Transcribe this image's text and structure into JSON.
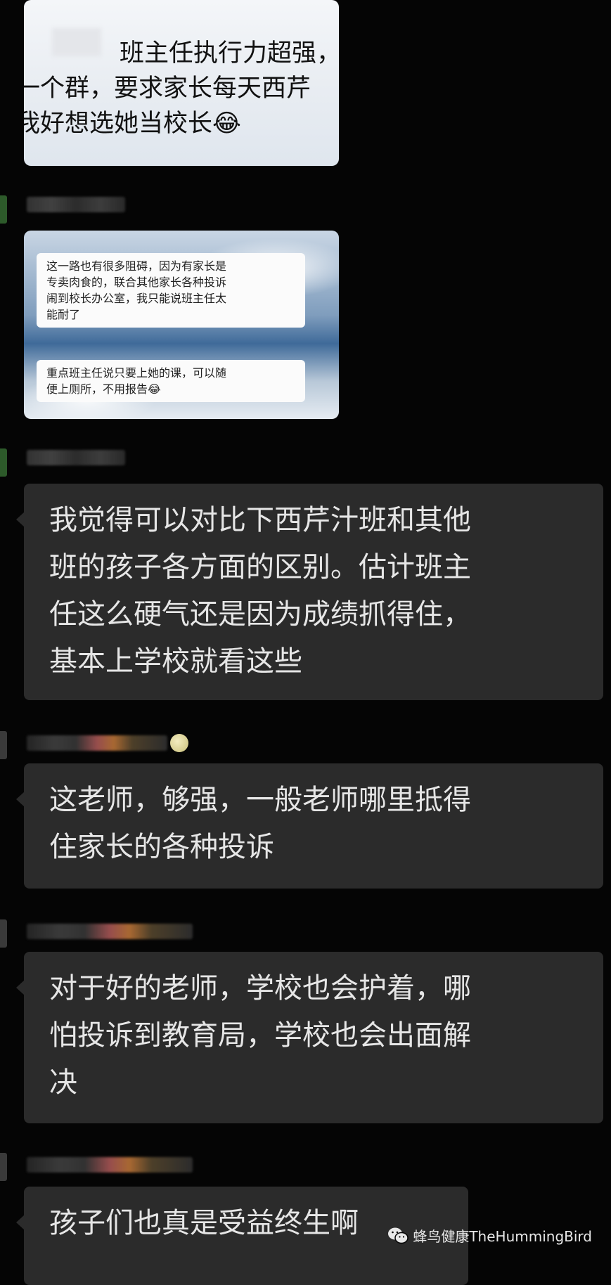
{
  "messages": [
    {
      "type": "image",
      "lines": [
        "班主任执行力超强，",
        "一个群，要求家长每天西芹",
        "我好想选她当校长😂"
      ]
    },
    {
      "type": "image",
      "bubbles": [
        {
          "lines": [
            "这一路也有很多阻碍，因为有家长是",
            "专卖肉食的，联合其他家长各种投诉",
            "闹到校长办公室，我只能说班主任太",
            "能耐了"
          ]
        },
        {
          "lines": [
            "重点班主任说只要上她的课，可以随",
            "便上厕所，不用报告😂"
          ]
        }
      ]
    },
    {
      "type": "text",
      "lines": [
        "我觉得可以对比下西芹汁班和其他",
        "班的孩子各方面的区别。估计班主",
        "任这么硬气还是因为成绩抓得住，",
        "基本上学校就看这些"
      ]
    },
    {
      "type": "text",
      "lines": [
        "这老师，够强，一般老师哪里抵得",
        "住家长的各种投诉"
      ]
    },
    {
      "type": "text",
      "lines": [
        "对于好的老师，学校也会护着，哪",
        "怕投诉到教育局，学校也会出面解",
        "决"
      ]
    },
    {
      "type": "text",
      "lines": [
        "孩子们也真是受益终生啊"
      ]
    }
  ],
  "watermark": {
    "text": "蜂鸟健康TheHummingBird",
    "icon": "wechat-icon"
  },
  "colors": {
    "background": "#050505",
    "bubble": "#2b2b2b",
    "bubble_text": "#e6e6e6"
  }
}
